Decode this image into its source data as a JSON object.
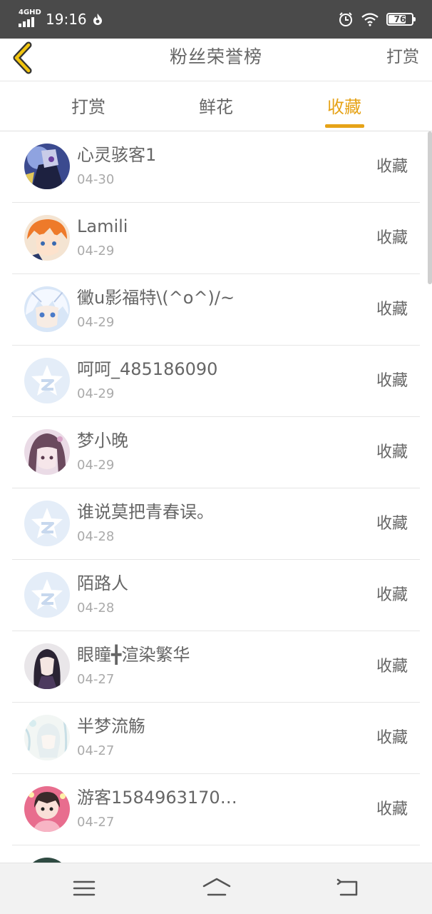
{
  "status_bar": {
    "network": "4GHD",
    "time": "19:16",
    "battery": "76",
    "battery_level": 0.76,
    "icons": [
      "signal-icon",
      "flame-icon",
      "alarm-icon",
      "wifi-icon",
      "battery-icon"
    ]
  },
  "nav": {
    "title": "粉丝荣誉榜",
    "action": "打赏",
    "back_icon": "chevron-left-icon",
    "accent_color": "#e6a318"
  },
  "tabs": [
    {
      "label": "打赏",
      "active": false
    },
    {
      "label": "鲜花",
      "active": false
    },
    {
      "label": "收藏",
      "active": true
    }
  ],
  "list": [
    {
      "name": "心灵骇客1",
      "date": "04-30",
      "action": "收藏",
      "avatar": "anime-robot-avatar"
    },
    {
      "name": "Lamili",
      "date": "04-29",
      "action": "收藏",
      "avatar": "anime-orange-hair-avatar"
    },
    {
      "name": "黴u影福特\\(^o^)/~",
      "date": "04-29",
      "action": "收藏",
      "avatar": "anime-white-hair-avatar"
    },
    {
      "name": "呵呵_485186090",
      "date": "04-29",
      "action": "收藏",
      "avatar": "default-star-avatar"
    },
    {
      "name": "梦小晚",
      "date": "04-29",
      "action": "收藏",
      "avatar": "anime-girl-avatar"
    },
    {
      "name": "谁说莫把青春误。",
      "date": "04-28",
      "action": "收藏",
      "avatar": "default-star-avatar"
    },
    {
      "name": "陌路人",
      "date": "04-28",
      "action": "收藏",
      "avatar": "default-star-avatar"
    },
    {
      "name": "眼瞳╋渲染繁华",
      "date": "04-27",
      "action": "收藏",
      "avatar": "dark-hair-girl-avatar"
    },
    {
      "name": "半梦流觞",
      "date": "04-27",
      "action": "收藏",
      "avatar": "pale-sketch-avatar"
    },
    {
      "name": "游客1584963170…",
      "date": "04-27",
      "action": "收藏",
      "avatar": "pink-girl-avatar"
    },
    {
      "name": "",
      "date": "",
      "action": "",
      "avatar": "partial-avatar"
    }
  ],
  "bottom_nav": {
    "icons": [
      "menu-icon",
      "home-icon",
      "back-icon"
    ]
  }
}
